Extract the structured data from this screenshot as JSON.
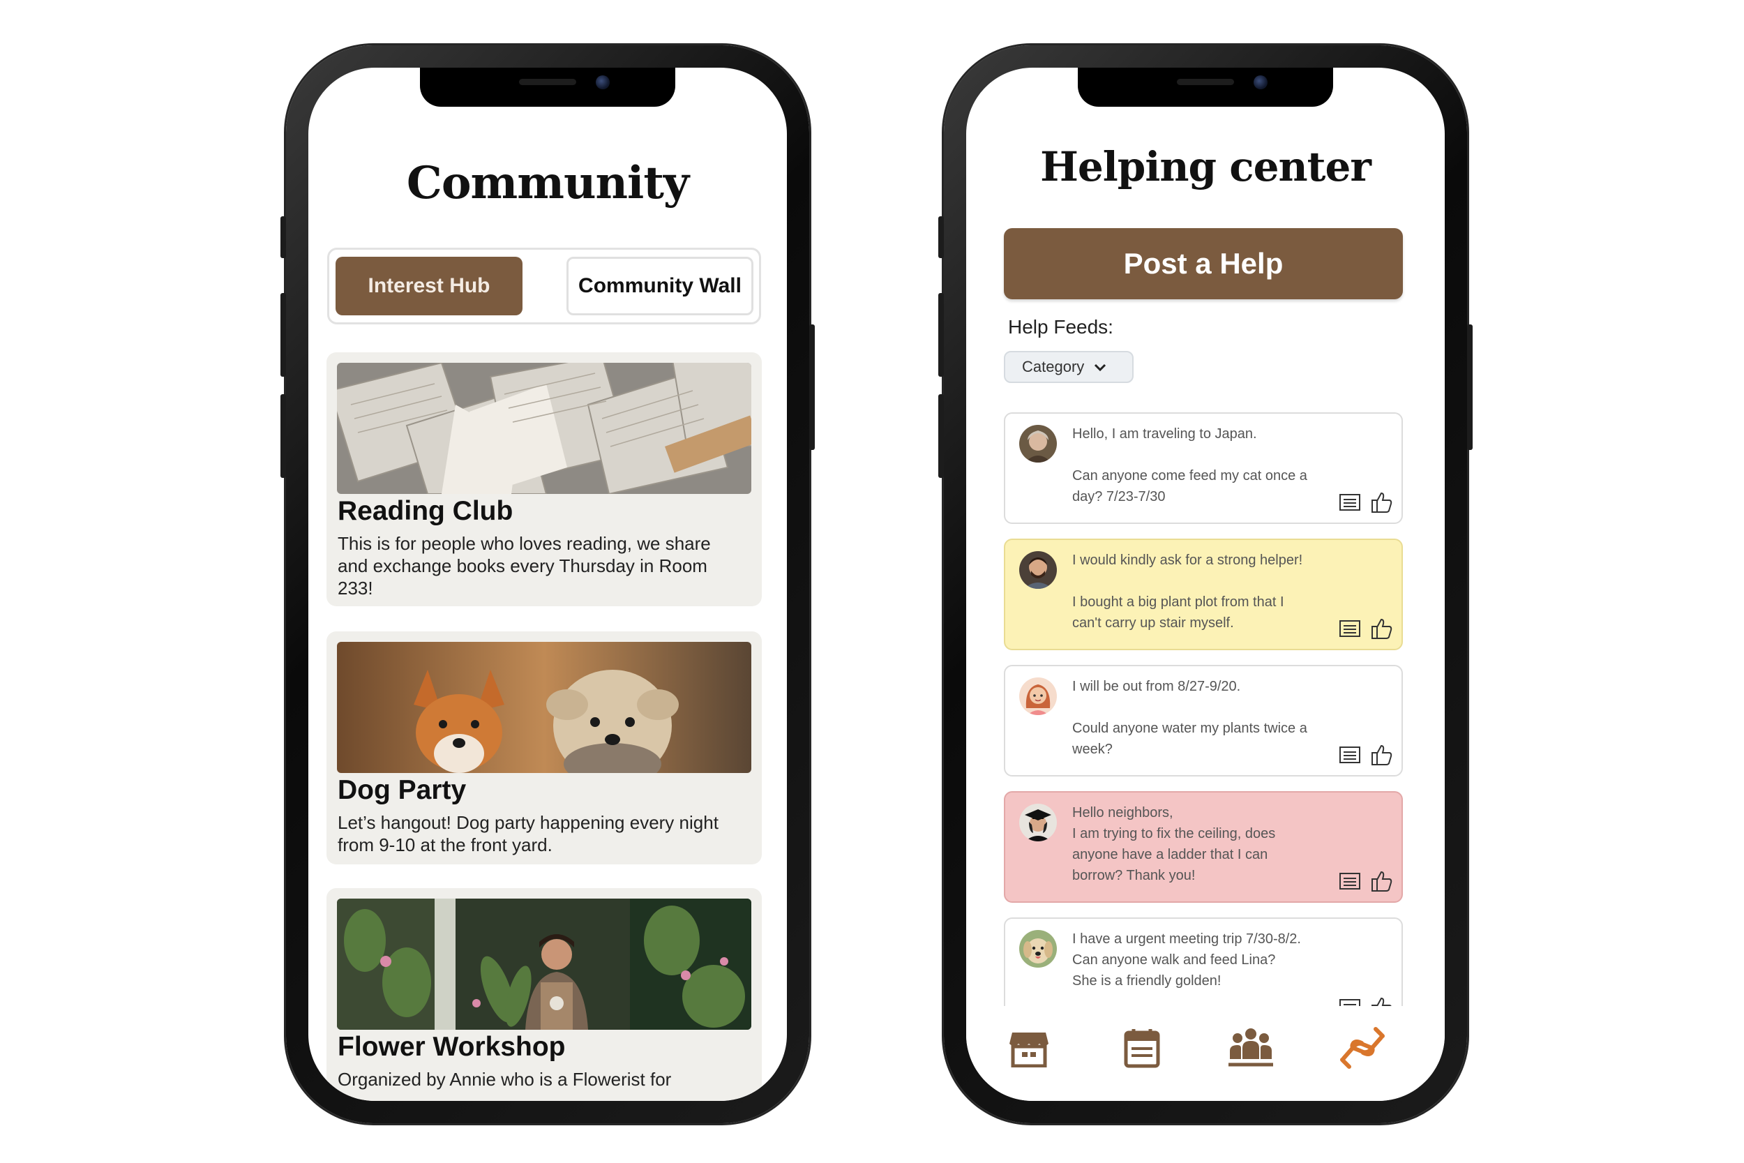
{
  "community": {
    "title": "Community",
    "tabs": [
      {
        "label": "Interest Hub",
        "active": true
      },
      {
        "label": "Community Wall",
        "active": false
      }
    ],
    "cards": [
      {
        "title": "Reading Club",
        "description": "This is for people who loves reading, we share and exchange books every Thursday in Room 233!",
        "image": "open-books-photo"
      },
      {
        "title": "Dog Party",
        "description": "Let’s hangout! Dog party happening every night from 9-10 at the front yard.",
        "image": "two-dogs-photo"
      },
      {
        "title": "Flower Workshop",
        "description": "Organized by Annie who is a Flowerist for",
        "image": "florist-photo"
      }
    ]
  },
  "helping_center": {
    "title": "Helping center",
    "post_button": "Post a Help",
    "feeds_label": "Help Feeds:",
    "category_filter": "Category",
    "posts": [
      {
        "color": "white",
        "line1": "Hello, I am traveling to Japan.",
        "line2": "Can anyone come feed my cat once a",
        "line3": "day? 7/23-7/30",
        "avatar": "elderly-woman-avatar"
      },
      {
        "color": "yellow",
        "line1": "I would kindly ask for a strong helper!",
        "line2": "I bought a big plant plot from that I",
        "line3": "can't carry up stair myself.",
        "avatar": "bearded-man-avatar"
      },
      {
        "color": "white",
        "line1": "I will be out from 8/27-9/20.",
        "line2": "Could anyone water my plants twice a",
        "line3": "week?",
        "avatar": "red-hair-girl-avatar"
      },
      {
        "color": "pink",
        "line1": "Hello neighbors,",
        "line2": "I am trying to fix the ceiling, does",
        "line3": "anyone have a ladder that I can",
        "line4": "borrow? Thank you!",
        "avatar": "graduate-avatar"
      },
      {
        "color": "white",
        "line1": "I have a urgent meeting trip 7/30-8/2.",
        "line2": "Can anyone walk and feed Lina?",
        "line3": "She is a friendly golden!",
        "avatar": "golden-dog-avatar"
      }
    ],
    "nav": [
      {
        "icon": "store-icon",
        "active": false
      },
      {
        "icon": "calendar-icon",
        "active": false
      },
      {
        "icon": "community-group-icon",
        "active": false
      },
      {
        "icon": "helping-hand-icon",
        "active": true
      }
    ],
    "colors": {
      "brand_brown": "#7b5b3f",
      "active_nav": "#d9762c",
      "yellow_post": "#fcf2b6",
      "pink_post": "#f4c5c5"
    }
  }
}
